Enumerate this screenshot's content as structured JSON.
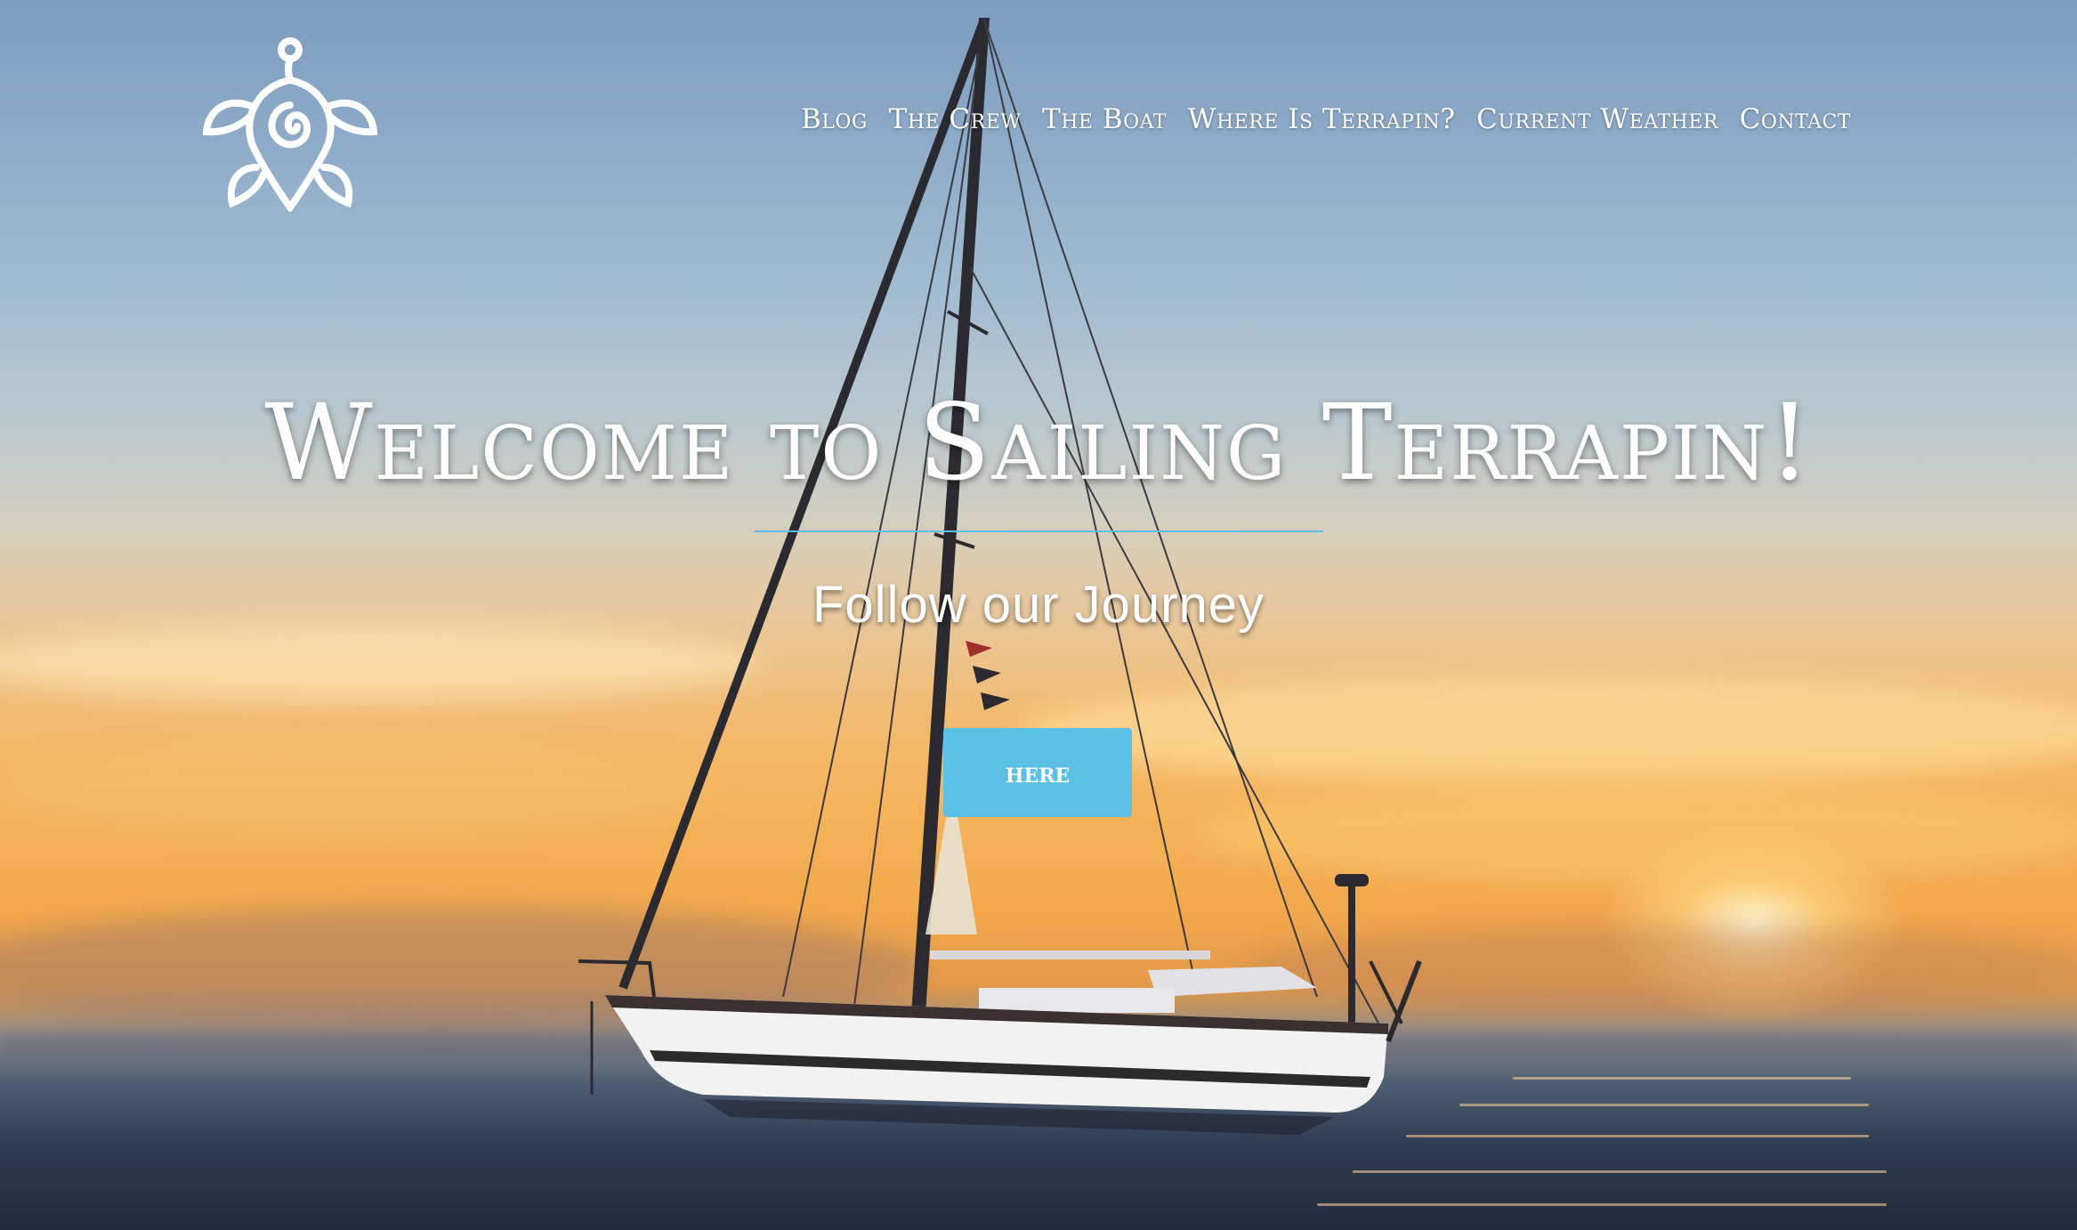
{
  "nav": {
    "items": [
      {
        "label": "Blog"
      },
      {
        "label": "The Crew"
      },
      {
        "label": "The Boat"
      },
      {
        "label": "Where Is Terrapin?"
      },
      {
        "label": "Current Weather"
      },
      {
        "label": "Contact"
      }
    ]
  },
  "hero": {
    "title": "Welcome to Sailing Terrapin!",
    "subtitle": "Follow our Journey",
    "button_label": "here"
  },
  "logo": {
    "icon": "turtle-spiral-icon",
    "color": "#ffffff"
  },
  "colors": {
    "accent": "#5bc0e5",
    "text": "#ffffff"
  }
}
